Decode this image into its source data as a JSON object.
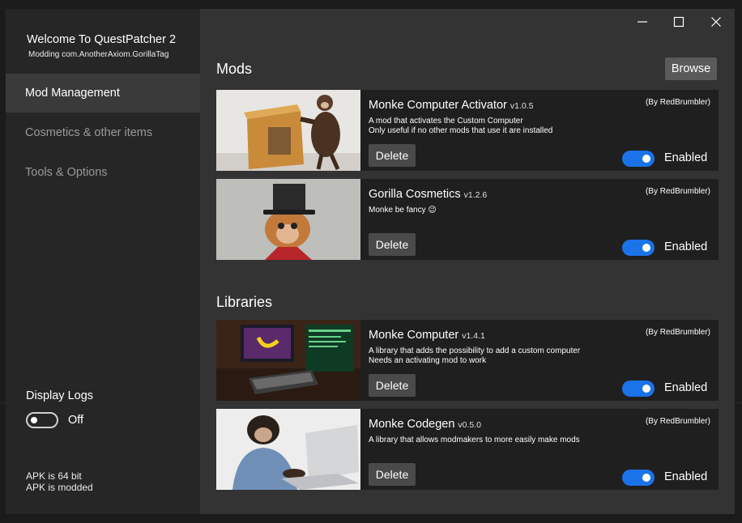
{
  "app": {
    "title": "Welcome To QuestPatcher 2",
    "subtitle": "Modding com.AnotherAxiom.GorillaTag"
  },
  "window_controls": {
    "minimize": "—",
    "maximize": "☐",
    "close": "✕"
  },
  "sidebar": {
    "items": [
      {
        "label": "Mod Management",
        "active": true
      },
      {
        "label": "Cosmetics & other items",
        "active": false
      },
      {
        "label": "Tools & Options",
        "active": false
      }
    ],
    "logs": {
      "label": "Display Logs",
      "state": "Off"
    },
    "apk": {
      "bits": "APK is 64 bit",
      "modded": "APK is modded"
    }
  },
  "mods_section": {
    "title": "Mods",
    "browse_label": "Browse",
    "items": [
      {
        "name": "Monke Computer Activator",
        "version": "v1.0.5",
        "author": "(By RedBrumbler)",
        "description": "A mod that activates the Custom Computer\nOnly useful if no other mods that use it are installed",
        "delete_label": "Delete",
        "state": "Enabled",
        "thumbnail": "monkey-with-box"
      },
      {
        "name": "Gorilla Cosmetics",
        "version": "v1.2.6",
        "author": "(By RedBrumbler)",
        "description": "Monke be fancy 😉",
        "delete_label": "Delete",
        "state": "Enabled",
        "thumbnail": "monkey-top-hat"
      }
    ]
  },
  "libraries_section": {
    "title": "Libraries",
    "items": [
      {
        "name": "Monke Computer",
        "version": "v1.4.1",
        "author": "(By RedBrumbler)",
        "description": "A library that adds the possibility to add a custom computer\nNeeds an activating mod to work",
        "delete_label": "Delete",
        "state": "Enabled",
        "thumbnail": "game-computer"
      },
      {
        "name": "Monke Codegen",
        "version": "v0.5.0",
        "author": "(By RedBrumbler)",
        "description": "A library that allows modmakers to more easily make mods",
        "delete_label": "Delete",
        "state": "Enabled",
        "thumbnail": "chimp-laptop"
      }
    ]
  },
  "colors": {
    "accent": "#1a73e8",
    "sidebar": "#262626",
    "content": "#333333",
    "card": "#1f1f1f"
  }
}
